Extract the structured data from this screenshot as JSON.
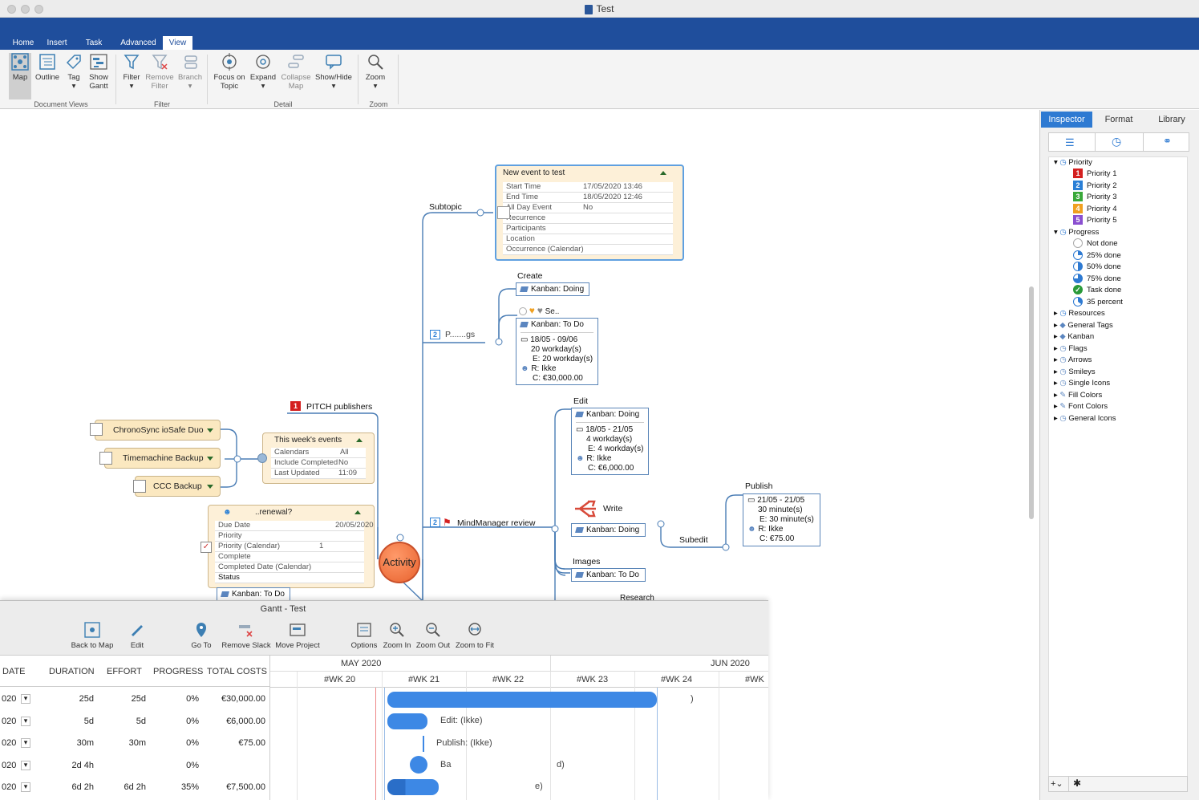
{
  "window": {
    "title": "Test"
  },
  "ribbon": {
    "tabs": [
      {
        "label": "Home"
      },
      {
        "label": "Insert"
      },
      {
        "label": "Task"
      },
      {
        "label": "Advanced"
      },
      {
        "label": "View"
      }
    ],
    "buttons": {
      "map": "Map",
      "outline": "Outline",
      "tag": "Tag",
      "show_gantt": "Show Gantt",
      "filter": "Filter",
      "remove_filter": "Remove Filter",
      "branch": "Branch",
      "focus_on_topic": "Focus on Topic",
      "expand": "Expand",
      "collapse_map": "Collapse Map",
      "show_hide": "Show/Hide",
      "zoom": "Zoom"
    },
    "groups": {
      "document_views": "Document Views",
      "filter": "Filter",
      "detail": "Detail",
      "zoom": "Zoom"
    }
  },
  "map": {
    "central": "Activity",
    "subtopic": "Subtopic",
    "event": {
      "title": "New event to test",
      "rows": [
        {
          "label": "Start Time",
          "value": "17/05/2020 13:46"
        },
        {
          "label": "End Time",
          "value": "18/05/2020 12:46"
        },
        {
          "label": "All Day Event",
          "value": "No"
        },
        {
          "label": "Recurrence",
          "value": ""
        },
        {
          "label": "Participants",
          "value": ""
        },
        {
          "label": "Location",
          "value": ""
        },
        {
          "label": "Occurrence (Calendar)",
          "value": ""
        }
      ]
    },
    "create": {
      "title": "Create",
      "kanban": "Kanban: Doing"
    },
    "planning": {
      "label": "P.......gs",
      "number": "2"
    },
    "sell": {
      "title": "Se..",
      "kanban": "Kanban: To Do",
      "dates": "18/05 - 09/06",
      "duration": "20 workday(s)",
      "effort": "E: 20 workday(s)",
      "resource": "R: Ikke",
      "cost": "C: €30,000.00"
    },
    "edit": {
      "title": "Edit",
      "kanban": "Kanban: Doing",
      "dates": "18/05 - 21/05",
      "duration": "4 workday(s)",
      "effort": "E: 4 workday(s)",
      "resource": "R: Ikke",
      "cost": "C: €6,000.00"
    },
    "review": {
      "number": "2",
      "label": "MindManager review"
    },
    "write": {
      "title": "Write",
      "kanban": "Kanban: Doing"
    },
    "subedit": "Subedit",
    "publish": {
      "title": "Publish",
      "dates": "21/05 - 21/05",
      "duration": "30 minute(s)",
      "effort": "E: 30 minute(s)",
      "resource": "R: Ikke",
      "cost": "C: €75.00"
    },
    "images": {
      "title": "Images",
      "kanban": "Kanban: To Do"
    },
    "research": "Research",
    "pitch": {
      "number": "1",
      "label": "PITCH publishers"
    },
    "events": {
      "title": "This week's events",
      "rows": [
        {
          "label": "Calendars",
          "value": "All"
        },
        {
          "label": "Include Completed",
          "value": "No"
        },
        {
          "label": "Last Updated",
          "value": "11:09"
        }
      ]
    },
    "backups": [
      {
        "label": "ChronoSync ioSafe Duo"
      },
      {
        "label": "Timemachine Backup"
      },
      {
        "label": "CCC Backup"
      }
    ],
    "renewal": {
      "title": "..renewal?",
      "rows": [
        {
          "label": "Due Date",
          "value": "20/05/2020"
        },
        {
          "label": "Priority",
          "value": ""
        },
        {
          "label": "Priority (Calendar)",
          "value": "1"
        },
        {
          "label": "Complete",
          "value": ""
        },
        {
          "label": "Completed Date (Calendar)",
          "value": ""
        },
        {
          "label": "Status",
          "value": ""
        }
      ],
      "kanban": "Kanban: To Do"
    }
  },
  "inspector": {
    "tabs": [
      {
        "label": "Inspector"
      },
      {
        "label": "Format"
      },
      {
        "label": "Library"
      }
    ],
    "priority": {
      "label": "Priority",
      "items": [
        {
          "label": "Priority 1",
          "num": "1",
          "color": "#d42020"
        },
        {
          "label": "Priority 2",
          "num": "2",
          "color": "#2a7fd6"
        },
        {
          "label": "Priority 3",
          "num": "3",
          "color": "#39a83a"
        },
        {
          "label": "Priority 4",
          "num": "4",
          "color": "#f0a020"
        },
        {
          "label": "Priority 5",
          "num": "5",
          "color": "#8a4fd0"
        }
      ]
    },
    "progress": {
      "label": "Progress",
      "items": [
        {
          "label": "Not done"
        },
        {
          "label": "25% done"
        },
        {
          "label": "50% done"
        },
        {
          "label": "75% done"
        },
        {
          "label": "Task done"
        },
        {
          "label": "35 percent"
        }
      ]
    },
    "groups": [
      {
        "label": "Resources"
      },
      {
        "label": "General Tags"
      },
      {
        "label": "Kanban"
      },
      {
        "label": "Flags"
      },
      {
        "label": "Arrows"
      },
      {
        "label": "Smileys"
      },
      {
        "label": "Single Icons"
      },
      {
        "label": "Fill Colors"
      },
      {
        "label": "Font Colors"
      },
      {
        "label": "General Icons"
      }
    ]
  },
  "gantt": {
    "title": "Gantt - Test",
    "toolbar": {
      "back_to_map": "Back to Map",
      "edit": "Edit",
      "go_to": "Go To",
      "remove_slack": "Remove Slack",
      "move_project": "Move Project",
      "options": "Options",
      "zoom_in": "Zoom In",
      "zoom_out": "Zoom Out",
      "zoom_to_fit": "Zoom to Fit"
    },
    "columns": {
      "date": "DATE",
      "duration": "DURATION",
      "effort": "EFFORT",
      "progress": "PROGRESS",
      "total_costs": "TOTAL COSTS"
    },
    "rows": [
      {
        "date": "020",
        "duration": "25d",
        "effort": "25d",
        "progress": "0%",
        "cost": "€30,000.00"
      },
      {
        "date": "020",
        "duration": "5d",
        "effort": "5d",
        "progress": "0%",
        "cost": "€6,000.00"
      },
      {
        "date": "020",
        "duration": "30m",
        "effort": "30m",
        "progress": "0%",
        "cost": "€75.00"
      },
      {
        "date": "020",
        "duration": "2d 4h",
        "effort": "",
        "progress": "0%",
        "cost": ""
      },
      {
        "date": "020",
        "duration": "6d 2h",
        "effort": "6d 2h",
        "progress": "35%",
        "cost": "€7,500.00"
      }
    ],
    "months": {
      "may": "MAY 2020",
      "jun": "JUN 2020"
    },
    "weeks": [
      "#WK 20",
      "#WK 21",
      "#WK 22",
      "#WK 23",
      "#WK 24",
      "#WK"
    ],
    "bar_labels": {
      "edit": "Edit: (Ikke)",
      "publish": "Publish: (Ikke)",
      "row4_a": "Ba",
      "row4_b": "d)",
      "row5": "e)",
      "row1": ")"
    }
  }
}
